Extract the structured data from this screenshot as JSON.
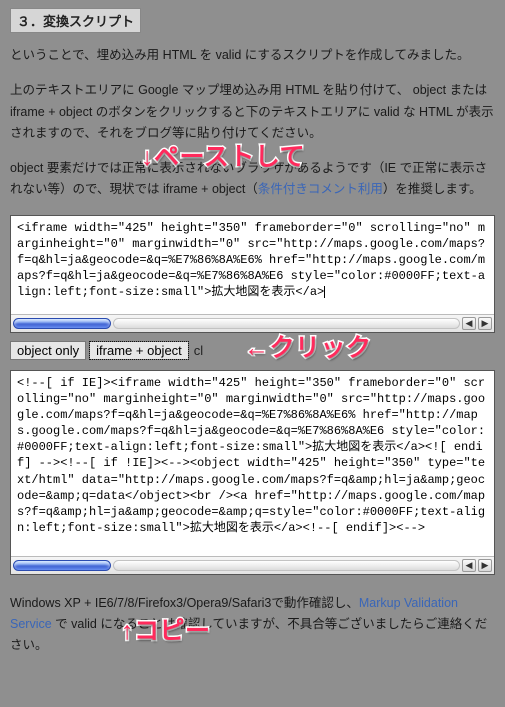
{
  "heading": "３．変換スクリプト",
  "para1": "ということで、埋め込み用 HTML を valid にするスクリプトを作成してみました。",
  "para2": "上のテキストエリアに Google マップ埋め込み用 HTML を貼り付けて、 object または iframe + object のボタンをクリックすると下のテキストエリアに valid な HTML が表示されますので、それをブログ等に貼り付けてください。",
  "para3_pre": "object 要素だけでは正常に表示されないブラウザがあるようです（IE で正常に表示されない等）ので、現状では iframe + object（",
  "para3_link": "条件付きコメント利用",
  "para3_post": "）を推奨します。",
  "textarea1": "<iframe width=\"425\" height=\"350\" frameborder=\"0\" scrolling=\"no\" marginheight=\"0\" marginwidth=\"0\" src=\"http://maps.google.com/maps?f=q&hl=ja&geocode=&q=%E7%86%8A%E6% href=\"http://maps.google.com/maps?f=q&hl=ja&geocode=&q=%E7%86%8A%E6 style=\"color:#0000FF;text-align:left;font-size:small\">拡大地図を表示</a>",
  "buttons": {
    "object_only": "object only",
    "iframe_object": "iframe + object",
    "clear_stub": "cl"
  },
  "textarea2": "<!--[ if IE]><iframe width=\"425\" height=\"350\" frameborder=\"0\" scrolling=\"no\" marginheight=\"0\" marginwidth=\"0\" src=\"http://maps.google.com/maps?f=q&hl=ja&geocode=&q=%E7%86%8A%E6% href=\"http://maps.google.com/maps?f=q&hl=ja&geocode=&q=%E7%86%8A%E6 style=\"color:#0000FF;text-align:left;font-size:small\">拡大地図を表示</a><![ endif] --><!--[ if !IE]><--><object width=\"425\" height=\"350\" type=\"text/html\" data=\"http://maps.google.com/maps?f=q&amp;hl=ja&amp;geocode=&amp;q=data</object><br /><a href=\"http://maps.google.com/maps?f=q&amp;hl=ja&amp;geocode=&amp;q=style=\"color:#0000FF;text-align:left;font-size:small\">拡大地図を表示</a><!--[ endif]><-->",
  "footer_pre": "Windows XP + IE6/7/8/Firefox3/Opera9/Safari3で動作確認し、",
  "footer_link": "Markup Validation Service",
  "footer_post": " で valid になることは確認していますが、不具合等ございましたらご連絡ください。",
  "callouts": {
    "paste": "↓ペーストして",
    "click": "←クリック",
    "copy": "↑コピー"
  },
  "scroll": {
    "left": "◀",
    "right": "▶"
  }
}
